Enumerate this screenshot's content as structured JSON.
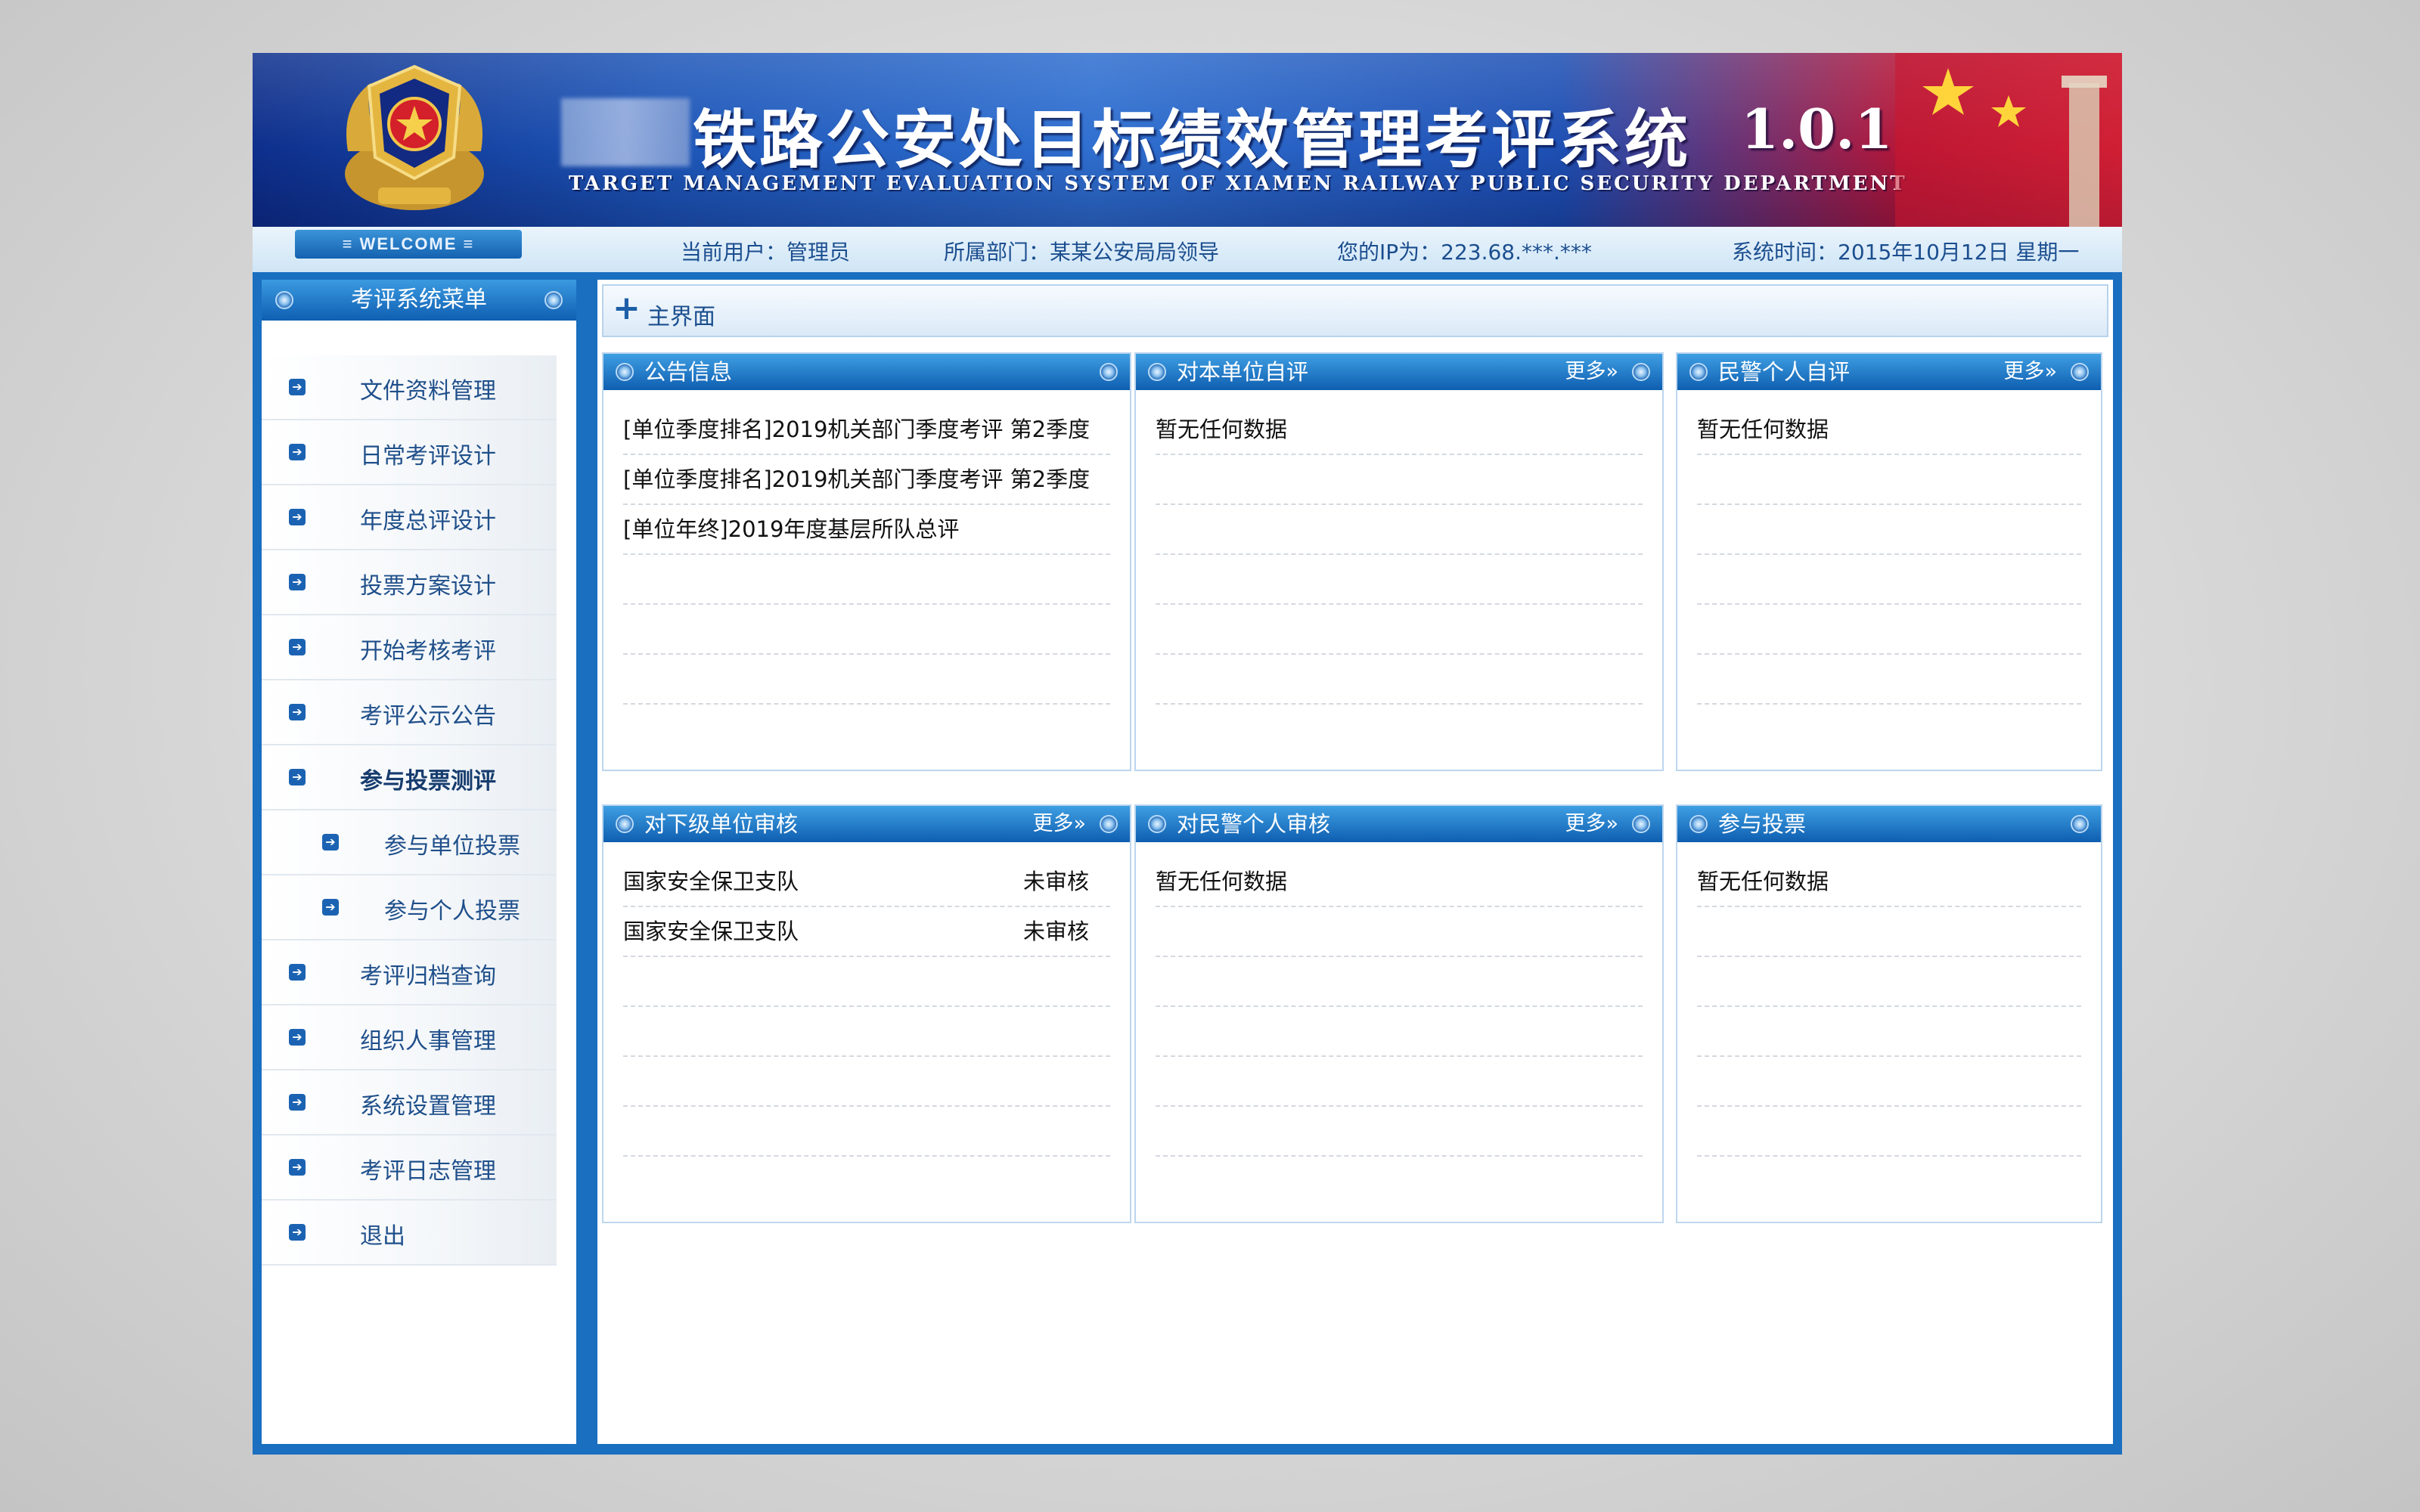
{
  "colors": {
    "accent": "#1a6fc0",
    "header_blue": "#0f5eb0",
    "text_link": "#1f4f8a"
  },
  "banner": {
    "title": "铁路公安处目标绩效管理考评系统",
    "version": "1.0.1",
    "subtitle": "TARGET MANAGEMENT EVALUATION SYSTEM OF XIAMEN RAILWAY PUBLIC SECURITY DEPARTMENT"
  },
  "statusbar": {
    "welcome": "≡ WELCOME ≡",
    "user": "当前用户：管理员",
    "dept": "所属部门：某某公安局局领导",
    "ip": "您的IP为：223.68.***.***",
    "time": "系统时间：2015年10月12日 星期一"
  },
  "sidebar": {
    "title": "考评系统菜单",
    "items": [
      {
        "label": "文件资料管理"
      },
      {
        "label": "日常考评设计"
      },
      {
        "label": "年度总评设计"
      },
      {
        "label": "投票方案设计"
      },
      {
        "label": "开始考核考评"
      },
      {
        "label": "考评公示公告"
      },
      {
        "label": "参与投票测评"
      },
      {
        "label": "参与单位投票"
      },
      {
        "label": "参与个人投票"
      },
      {
        "label": "考评归档查询"
      },
      {
        "label": "组织人事管理"
      },
      {
        "label": "系统设置管理"
      },
      {
        "label": "考评日志管理"
      },
      {
        "label": "退出"
      }
    ]
  },
  "main": {
    "breadcrumb": "主界面",
    "more_label": "更多»",
    "panels": [
      {
        "title": "公告信息",
        "rows": [
          {
            "text": "[单位季度排名]2019机关部门季度考评 第2季度"
          },
          {
            "text": "[单位季度排名]2019机关部门季度考评 第2季度"
          },
          {
            "text": "[单位年终]2019年度基层所队总评"
          }
        ]
      },
      {
        "title": "对本单位自评",
        "rows": [
          {
            "text": "暂无任何数据"
          }
        ]
      },
      {
        "title": "民警个人自评",
        "rows": [
          {
            "text": "暂无任何数据"
          }
        ]
      },
      {
        "title": "对下级单位审核",
        "rows": [
          {
            "text": "国家安全保卫支队",
            "status": "未审核"
          },
          {
            "text": "国家安全保卫支队",
            "status": "未审核"
          }
        ]
      },
      {
        "title": "对民警个人审核",
        "rows": [
          {
            "text": "暂无任何数据"
          }
        ]
      },
      {
        "title": "参与投票",
        "rows": [
          {
            "text": "暂无任何数据"
          }
        ]
      }
    ]
  }
}
